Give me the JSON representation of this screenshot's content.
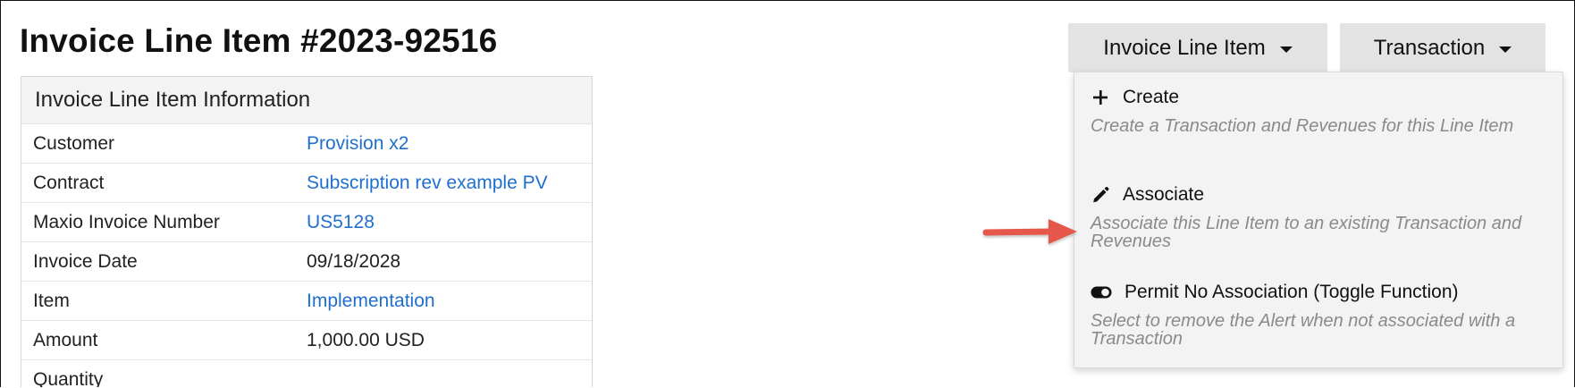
{
  "page": {
    "title": "Invoice Line Item #2023-92516"
  },
  "info_panel": {
    "header": "Invoice Line Item Information",
    "rows": [
      {
        "label": "Customer",
        "value": "Provision x2",
        "link": true
      },
      {
        "label": "Contract",
        "value": "Subscription rev example PV",
        "link": true
      },
      {
        "label": "Maxio Invoice Number",
        "value": "US5128",
        "link": true
      },
      {
        "label": "Invoice Date",
        "value": "09/18/2028",
        "link": false
      },
      {
        "label": "Item",
        "value": "Implementation",
        "link": true
      },
      {
        "label": "Amount",
        "value": "1,000.00 USD",
        "link": false
      },
      {
        "label": "Quantity",
        "value": "",
        "link": false
      }
    ]
  },
  "toolbar": {
    "invoice_line_item_label": "Invoice Line Item",
    "transaction_label": "Transaction"
  },
  "dropdown": {
    "items": [
      {
        "icon": "plus-icon",
        "title": "Create",
        "description": "Create a Transaction and Revenues for this Line Item"
      },
      {
        "icon": "pencil-icon",
        "title": "Associate",
        "description": "Associate this Line Item to an existing Transaction and Revenues"
      },
      {
        "icon": "toggle-icon",
        "title": "Permit No Association (Toggle Function)",
        "description": "Select to remove the Alert when not associated with a Transaction"
      }
    ]
  },
  "colors": {
    "link": "#1f6fd1",
    "annotation_arrow": "#e5574b",
    "button_bg": "#e3e3e3",
    "menu_bg": "#f3f3f3",
    "menu_desc": "#8a8a8a"
  }
}
